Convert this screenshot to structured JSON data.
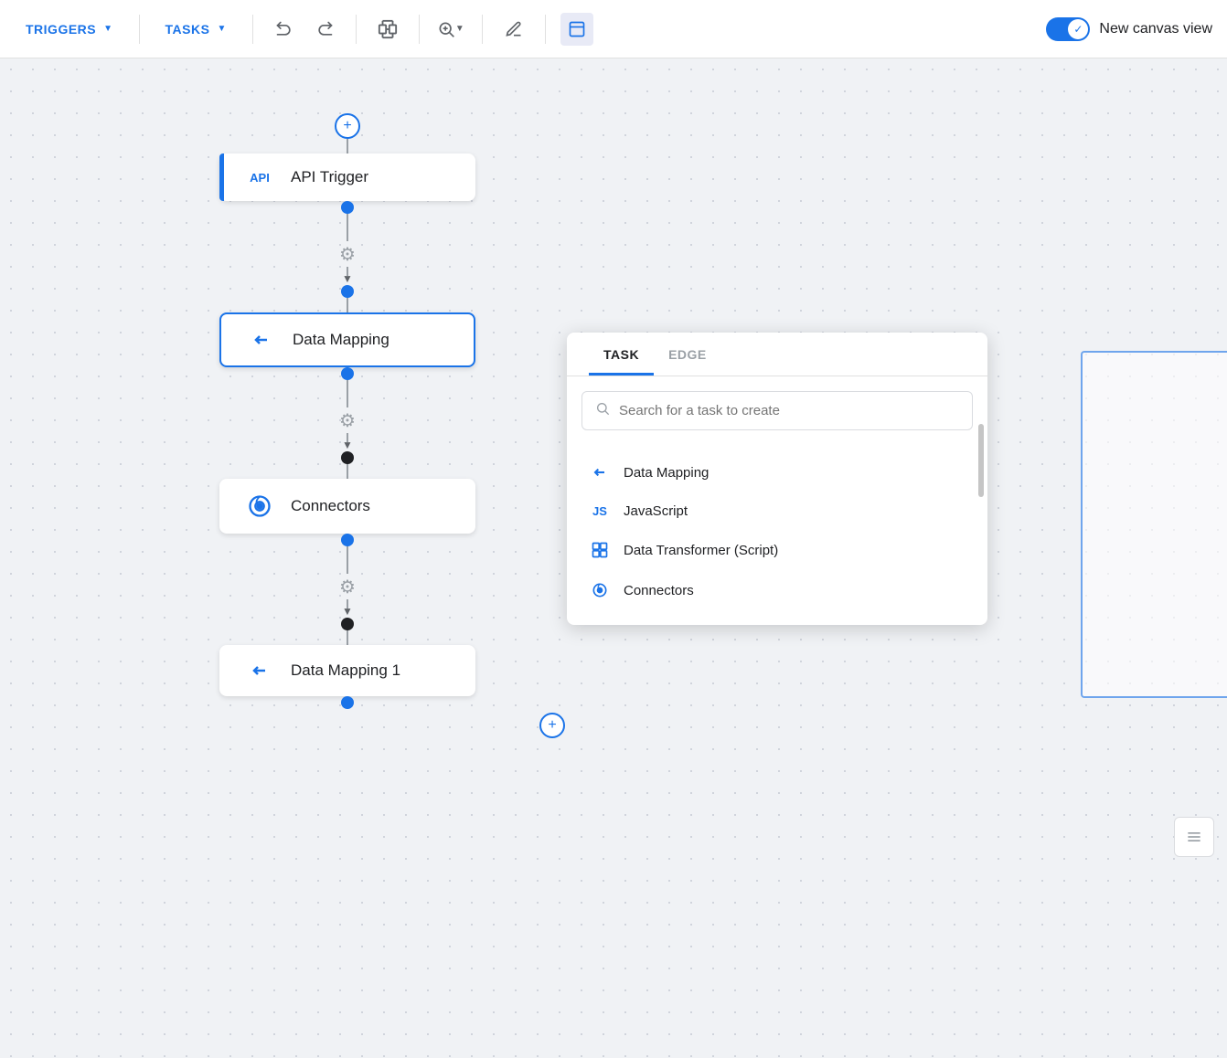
{
  "toolbar": {
    "triggers_label": "TRIGGERS",
    "tasks_label": "TASKS",
    "new_canvas_label": "New canvas view"
  },
  "flow": {
    "nodes": [
      {
        "id": "api-trigger",
        "label": "API Trigger",
        "type": "api",
        "icon": "API"
      },
      {
        "id": "data-mapping",
        "label": "Data Mapping",
        "type": "data-mapping",
        "selected": true
      },
      {
        "id": "connectors",
        "label": "Connectors",
        "type": "connectors"
      },
      {
        "id": "data-mapping-1",
        "label": "Data Mapping 1",
        "type": "data-mapping"
      }
    ]
  },
  "task_panel": {
    "tabs": [
      {
        "id": "task",
        "label": "TASK",
        "active": true
      },
      {
        "id": "edge",
        "label": "EDGE",
        "active": false
      }
    ],
    "search_placeholder": "Search for a task to create",
    "items": [
      {
        "id": "data-mapping",
        "label": "Data Mapping",
        "icon": "data-mapping"
      },
      {
        "id": "javascript",
        "label": "JavaScript",
        "icon": "js"
      },
      {
        "id": "data-transformer",
        "label": "Data Transformer (Script)",
        "icon": "transformer"
      },
      {
        "id": "connectors",
        "label": "Connectors",
        "icon": "connectors"
      }
    ]
  }
}
